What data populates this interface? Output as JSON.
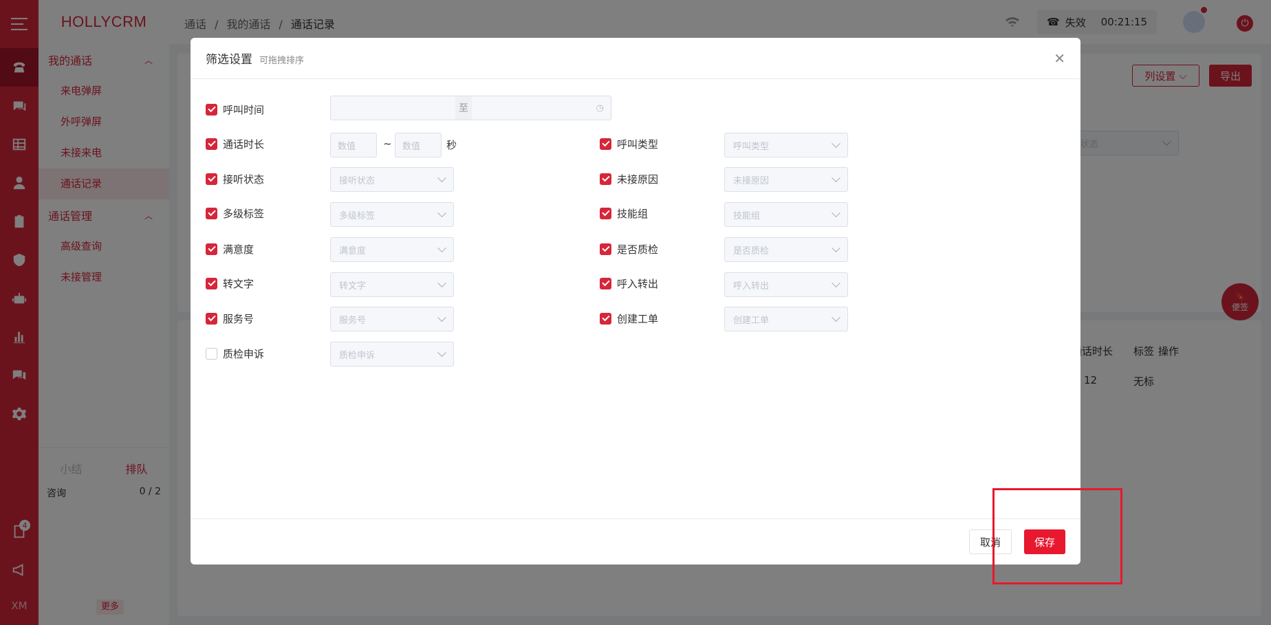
{
  "app": {
    "logo": "HOLLYCRM"
  },
  "rail": {
    "badge_count": "4",
    "xm": "XM"
  },
  "sidebar": {
    "group1": {
      "label": "我的通话"
    },
    "group1_items": [
      {
        "label": "来电弹屏"
      },
      {
        "label": "外呼弹屏"
      },
      {
        "label": "未接来电"
      },
      {
        "label": "通话记录"
      }
    ],
    "group2": {
      "label": "通话管理"
    },
    "group2_items": [
      {
        "label": "高级查询"
      },
      {
        "label": "未接管理"
      }
    ],
    "queue": {
      "tab_summary": "小结",
      "tab_queue": "排队",
      "row_label": "咨询",
      "row_value": "0 / 2"
    },
    "more": "更多"
  },
  "breadcrumb": {
    "a": "通话",
    "b": "我的通话",
    "c": "通话记录",
    "sep": "/"
  },
  "status": {
    "phone_state": "失效",
    "timer": "00:21:15"
  },
  "background": {
    "col_settings": "列设置",
    "export": "导出",
    "status_select": "状态",
    "col_duration": "通话时长",
    "col_tag": "标签",
    "col_action": "操作",
    "cell_duration": "12",
    "cell_tag": "无标",
    "note": "便签"
  },
  "modal": {
    "title": "筛选设置",
    "subtitle": "可拖拽排序",
    "range_sep": "至",
    "num_placeholder": "数值",
    "tilde": "~",
    "seconds": "秒",
    "left": [
      {
        "label": "呼叫时间",
        "checked": true
      },
      {
        "label": "通话时长",
        "checked": true
      },
      {
        "label": "接听状态",
        "checked": true,
        "placeholder": "接听状态"
      },
      {
        "label": "多级标签",
        "checked": true,
        "placeholder": "多级标签"
      },
      {
        "label": "满意度",
        "checked": true,
        "placeholder": "满意度"
      },
      {
        "label": "转文字",
        "checked": true,
        "placeholder": "转文字"
      },
      {
        "label": "服务号",
        "checked": true,
        "placeholder": "服务号"
      },
      {
        "label": "质检申诉",
        "checked": false,
        "placeholder": "质检申诉"
      }
    ],
    "right": [
      {
        "label": "呼叫类型",
        "checked": true,
        "placeholder": "呼叫类型"
      },
      {
        "label": "未接原因",
        "checked": true,
        "placeholder": "未接原因"
      },
      {
        "label": "技能组",
        "checked": true,
        "placeholder": "技能组"
      },
      {
        "label": "是否质检",
        "checked": true,
        "placeholder": "是否质检"
      },
      {
        "label": "呼入转出",
        "checked": true,
        "placeholder": "呼入转出"
      },
      {
        "label": "创建工单",
        "checked": true,
        "placeholder": "创建工单"
      }
    ],
    "cancel": "取消",
    "save": "保存"
  },
  "colors": {
    "brand": "#d6263a",
    "save": "#e8182e"
  }
}
